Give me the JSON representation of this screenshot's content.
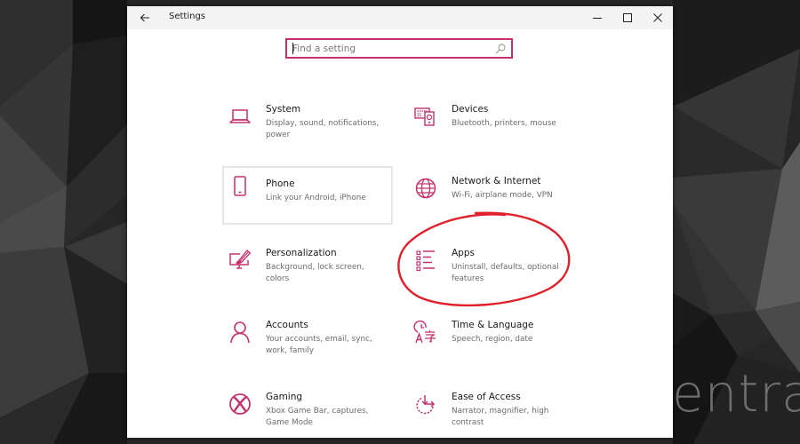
{
  "window": {
    "title": "Settings",
    "controls": {
      "back": "back-arrow-icon",
      "minimize": "minimize-icon",
      "maximize": "maximize-icon",
      "close": "close-icon"
    }
  },
  "search": {
    "placeholder": "Find a setting",
    "value": "",
    "icon": "search-icon"
  },
  "accent_color": "#c3326e",
  "annotation_color": "#e0202a",
  "categories": [
    {
      "id": "system",
      "label": "System",
      "description": "Display, sound, notifications, power",
      "icon": "laptop-icon"
    },
    {
      "id": "devices",
      "label": "Devices",
      "description": "Bluetooth, printers, mouse",
      "icon": "keyboard-speaker-icon"
    },
    {
      "id": "phone",
      "label": "Phone",
      "description": "Link your Android, iPhone",
      "icon": "phone-icon",
      "focused": true
    },
    {
      "id": "network",
      "label": "Network & Internet",
      "description": "Wi-Fi, airplane mode, VPN",
      "icon": "globe-icon"
    },
    {
      "id": "personalization",
      "label": "Personalization",
      "description": "Background, lock screen, colors",
      "icon": "paintbrush-monitor-icon"
    },
    {
      "id": "apps",
      "label": "Apps",
      "description": "Uninstall, defaults, optional features",
      "icon": "apps-list-icon",
      "highlighted": true
    },
    {
      "id": "accounts",
      "label": "Accounts",
      "description": "Your accounts, email, sync, work, family",
      "icon": "person-icon"
    },
    {
      "id": "time-language",
      "label": "Time & Language",
      "description": "Speech, region, date",
      "icon": "clock-language-icon"
    },
    {
      "id": "gaming",
      "label": "Gaming",
      "description": "Xbox Game Bar, captures, Game Mode",
      "icon": "xbox-icon"
    },
    {
      "id": "ease-of-access",
      "label": "Ease of Access",
      "description": "Narrator, magnifier, high contrast",
      "icon": "ease-of-access-icon"
    }
  ],
  "watermark": {
    "text": "entral"
  }
}
